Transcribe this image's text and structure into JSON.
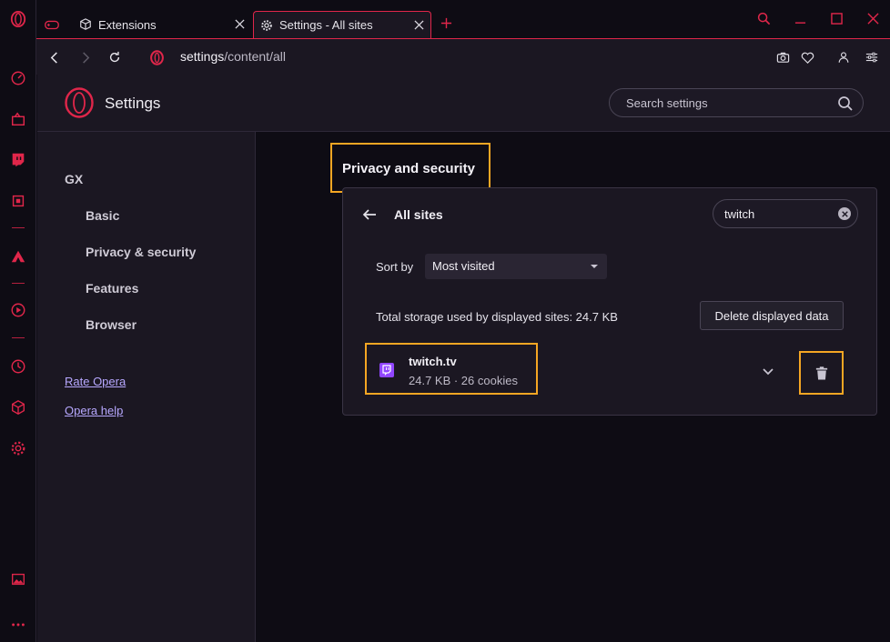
{
  "tabs": [
    {
      "label": "Extensions",
      "icon": "puzzle-cube-icon"
    },
    {
      "label": "Settings - All sites",
      "icon": "gear-icon"
    }
  ],
  "address": {
    "host": "settings",
    "path": "/content/all"
  },
  "settings": {
    "title": "Settings",
    "search_placeholder": "Search settings"
  },
  "nav": {
    "group": "GX",
    "items": [
      "Basic",
      "Privacy & security",
      "Features",
      "Browser"
    ],
    "links": [
      "Rate Opera",
      "Opera help"
    ]
  },
  "content": {
    "section_title": "Privacy and security",
    "card_heading": "All sites",
    "filter_value": "twitch",
    "sort_label": "Sort by",
    "sort_value": "Most visited",
    "storage_text": "Total storage used by displayed sites: 24.7 KB",
    "delete_label": "Delete displayed data",
    "site": {
      "name": "twitch.tv",
      "meta": "24.7 KB · 26 cookies"
    }
  },
  "colors": {
    "accent": "#e0264a",
    "highlight": "#f5a623",
    "panel": "#1b1722",
    "background": "#0e0c14",
    "twitch": "#9146ff"
  }
}
